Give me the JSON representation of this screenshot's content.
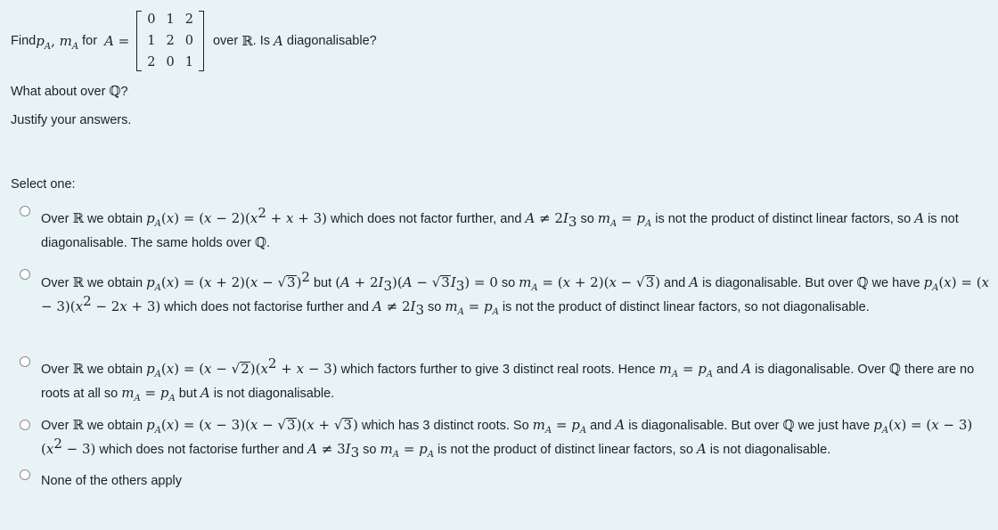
{
  "question": {
    "prefix": "Find ",
    "pA": "p",
    "mA": "m",
    "sub_A": "A",
    "for_text": " for ",
    "A_eq": "A =",
    "matrix": [
      [
        "0",
        "1",
        "2"
      ],
      [
        "1",
        "2",
        "0"
      ],
      [
        "2",
        "0",
        "1"
      ]
    ],
    "over_text": " over ",
    "R": "ℝ",
    "is_text": ". Is ",
    "A": "A",
    "diag_q": " diagonalisable?",
    "line2_prefix": "What about over ",
    "Q": "ℚ",
    "line2_suffix": "?",
    "line3": "Justify your answers."
  },
  "select_label": "Select one:",
  "options": [
    {
      "id": "a",
      "selected": false,
      "text": "Over ℝ we obtain pA(x) = (x − 2)(x² + x + 3) which does not factor further, and A ≠ 2I₃ so mA = pA is not the product of distinct linear factors, so A is not diagonalisable. The same holds over ℚ."
    },
    {
      "id": "b",
      "selected": false,
      "text": "Over ℝ we obtain pA(x) = (x + 2)(x − √3)² but (A + 2I₃)(A − √3I₃) = 0 so mA = (x + 2)(x − √3) and A is diagonalisable. But over ℚ we have pA(x) = (x − 3)(x² − 2x + 3) which does not factorise further and A ≠ 2I₃ so mA = pA is not the product of distinct linear factors, so not diagonalisable."
    },
    {
      "id": "c",
      "selected": false,
      "text": "Over ℝ we obtain pA(x) = (x − √2)(x² + x − 3) which factors further to give 3 distinct real roots. Hence mA = pA and A is diagonalisable. Over ℚ there are no roots at all so mA = pA but A is not diagonalisable."
    },
    {
      "id": "d",
      "selected": false,
      "text": "Over ℝ we obtain pA(x) = (x − 3)(x − √3)(x + √3) which has 3 distinct roots. So mA = pA and A is diagonalisable. But over ℚ we just have pA(x) = (x − 3)(x² − 3) which does not factorise further and A ≠ 3I₃ so mA = pA is not the product of distinct linear factors, so A is not diagonalisable."
    },
    {
      "id": "e",
      "selected": false,
      "text": "None of the others apply"
    }
  ],
  "tokens": {
    "over": "Over ",
    "we_obtain": " we obtain ",
    "R": "ℝ",
    "Q": "ℚ",
    "p": "p",
    "m": "m",
    "A": "A",
    "x": "x",
    "I": "I",
    "sub3": "3",
    "eq": " = ",
    "neq": " ≠ ",
    "sq": "2"
  },
  "colors": {
    "background": "#e7f3f5",
    "text": "#1d2125",
    "radio_border": "#8a8d90"
  }
}
